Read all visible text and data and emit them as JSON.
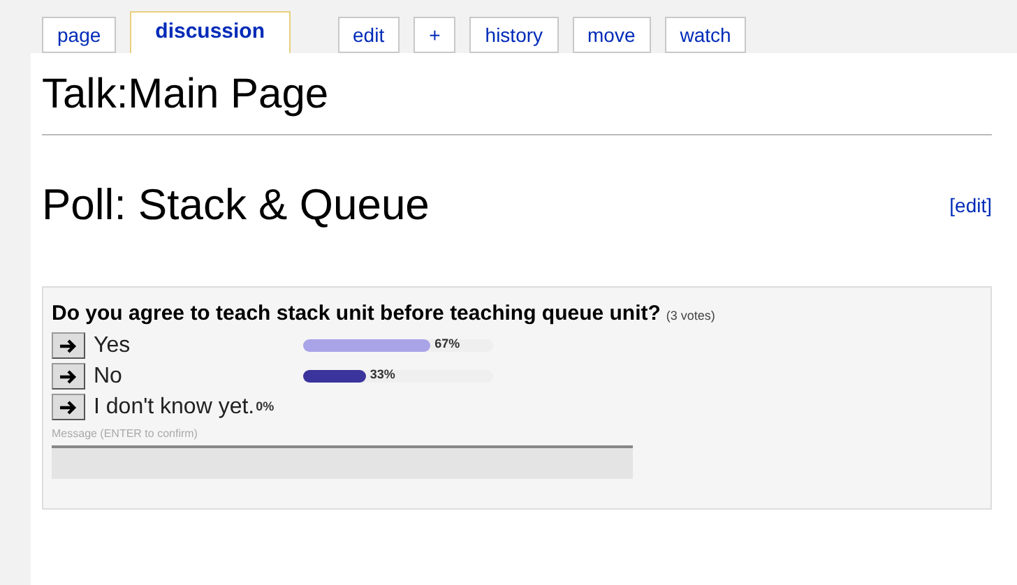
{
  "tabs": [
    {
      "label": "page",
      "selected": false
    },
    {
      "label": "discussion",
      "selected": true
    },
    {
      "label": "edit",
      "selected": false
    },
    {
      "label": "+",
      "selected": false
    },
    {
      "label": "history",
      "selected": false
    },
    {
      "label": "move",
      "selected": false
    },
    {
      "label": "watch",
      "selected": false
    }
  ],
  "page_title": "Talk:Main Page",
  "section": {
    "heading": "Poll: Stack & Queue",
    "edit_link": "[edit]"
  },
  "poll": {
    "question": "Do you agree to teach stack unit before teaching queue unit?",
    "votes": "(3 votes)",
    "options": [
      {
        "label": "Yes",
        "level": 0.67,
        "percent": "67%",
        "color": "#a9a3e8"
      },
      {
        "label": "No",
        "level": 0.33,
        "percent": "33%",
        "color": "#3b349c"
      },
      {
        "label": "I don't know yet.",
        "level": 0,
        "percent": "0%"
      }
    ],
    "message_label": "Message (ENTER to confirm)"
  }
}
